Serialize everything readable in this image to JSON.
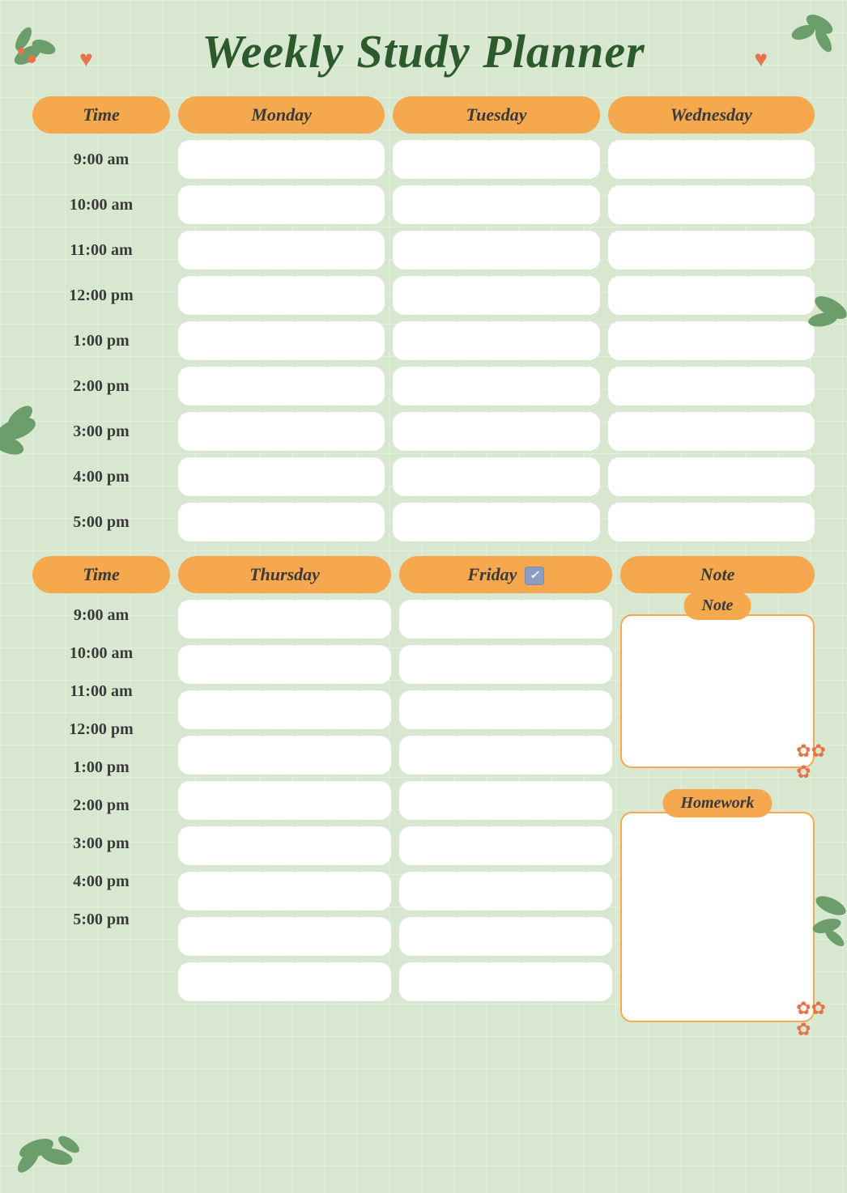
{
  "title": "Weekly Study Planner",
  "top_section": {
    "headers": [
      "Time",
      "Monday",
      "Tuesday",
      "Wednesday"
    ],
    "time_slots": [
      "9:00 am",
      "10:00 am",
      "11:00 am",
      "12:00 pm",
      "1:00 pm",
      "2:00 pm",
      "3:00 pm",
      "4:00 pm",
      "5:00 pm"
    ]
  },
  "bottom_section": {
    "headers": [
      "Time",
      "Thursday",
      "Friday",
      "Note"
    ],
    "time_slots": [
      "9:00 am",
      "10:00 am",
      "11:00 am",
      "12:00 pm",
      "1:00 pm",
      "2:00 pm",
      "3:00 pm",
      "4:00 pm",
      "5:00 pm"
    ],
    "note_label": "Note",
    "homework_label": "Homework"
  },
  "accent_color": "#f5a84e",
  "bg_color": "#d8e8d0",
  "text_color": "#2d5a2d",
  "heart_symbol": "♥",
  "flower_symbol": "✿"
}
